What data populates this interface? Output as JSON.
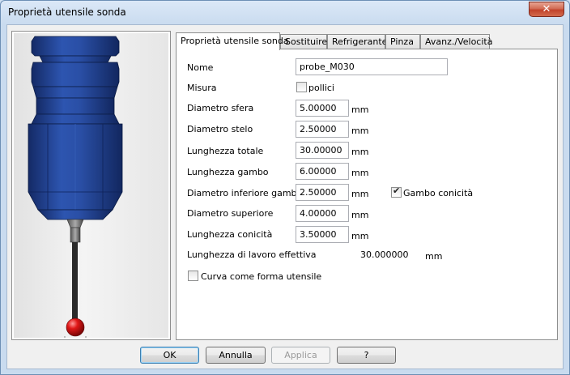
{
  "window": {
    "title": "Proprietà utensile sonda",
    "close_glyph": "✕"
  },
  "tabs": [
    {
      "label": "Proprietà utensile sonda",
      "active": true
    },
    {
      "label": "Sostituire",
      "active": false
    },
    {
      "label": "Refrigerante",
      "active": false
    },
    {
      "label": "Pinza",
      "active": false
    },
    {
      "label": "Avanz./Velocità",
      "active": false
    }
  ],
  "form": {
    "nome_label": "Nome",
    "nome_value": "probe_M030",
    "misura_label": "Misura",
    "pollici_label": "pollici",
    "pollici_checked": false,
    "diametro_sfera_label": "Diametro sfera",
    "diametro_sfera_value": "5.00000",
    "diametro_stelo_label": "Diametro stelo",
    "diametro_stelo_value": "2.50000",
    "lunghezza_totale_label": "Lunghezza totale",
    "lunghezza_totale_value": "30.00000",
    "lunghezza_gambo_label": "Lunghezza gambo",
    "lunghezza_gambo_value": "6.00000",
    "diametro_inferiore_gambo_label": "Diametro inferiore gambo",
    "diametro_inferiore_gambo_value": "2.50000",
    "gambo_conicita_label": "Gambo conicità",
    "gambo_conicita_checked": true,
    "diametro_superiore_label": "Diametro superiore",
    "diametro_superiore_value": "4.00000",
    "lunghezza_conicita_label": "Lunghezza conicità",
    "lunghezza_conicita_value": "3.50000",
    "lunghezza_lavoro_label": "Lunghezza di lavoro effettiva",
    "lunghezza_lavoro_value": "30.000000",
    "curva_label": "Curva come forma utensile",
    "curva_checked": false,
    "unit": "mm"
  },
  "buttons": {
    "ok": "OK",
    "annulla": "Annulla",
    "applica": "Applica",
    "help": "?"
  },
  "colors": {
    "probe_body": "#1f3f8e",
    "probe_ball": "#d01616",
    "stylus": "#2a2a2a"
  }
}
